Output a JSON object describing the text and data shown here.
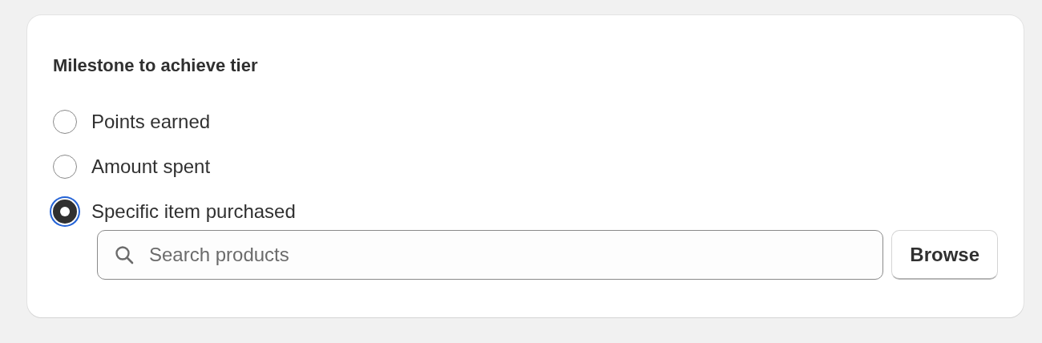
{
  "card": {
    "title": "Milestone to achieve tier",
    "options": [
      {
        "label": "Points earned",
        "selected": false
      },
      {
        "label": "Amount spent",
        "selected": false
      },
      {
        "label": "Specific item purchased",
        "selected": true
      }
    ],
    "search": {
      "placeholder": "Search products"
    },
    "browse_button": "Browse"
  }
}
